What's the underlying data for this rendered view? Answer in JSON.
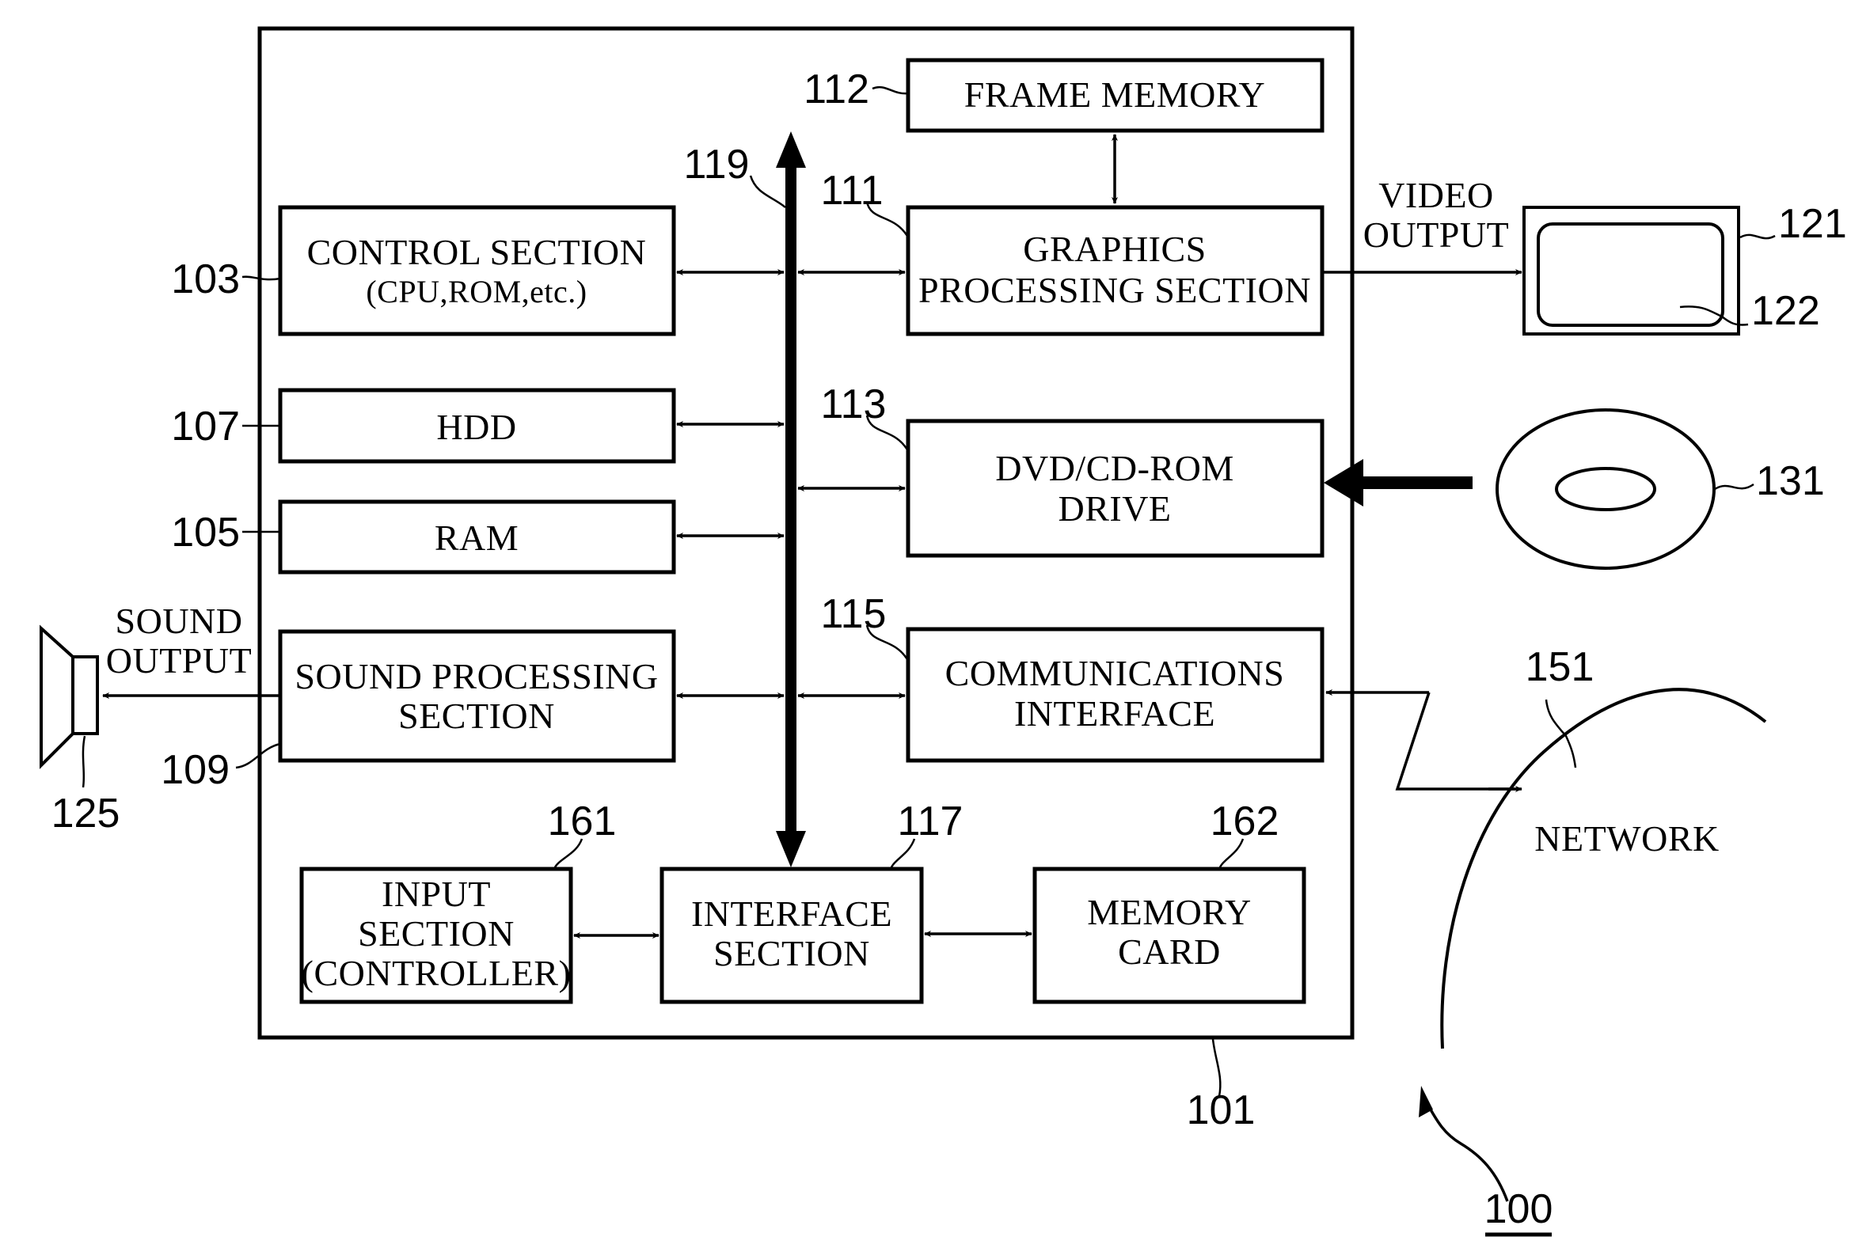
{
  "figure": {
    "system_ref": "100",
    "device_ref": "101",
    "bus_ref": "119"
  },
  "blocks": {
    "frame_memory": {
      "ref": "112",
      "lines": [
        "FRAME  MEMORY"
      ]
    },
    "graphics": {
      "ref": "111",
      "lines": [
        "GRAPHICS",
        "PROCESSING SECTION"
      ]
    },
    "control": {
      "ref": "103",
      "lines": [
        "CONTROL  SECTION",
        "(CPU,ROM,etc.)"
      ]
    },
    "hdd": {
      "ref": "107",
      "lines": [
        "HDD"
      ]
    },
    "ram": {
      "ref": "105",
      "lines": [
        "RAM"
      ]
    },
    "dvd": {
      "ref": "113",
      "lines": [
        "DVD/CD-ROM",
        "DRIVE"
      ]
    },
    "sound": {
      "ref": "109",
      "lines": [
        "SOUND  PROCESSING",
        "SECTION"
      ]
    },
    "comm": {
      "ref": "115",
      "lines": [
        "COMMUNICATIONS",
        "INTERFACE"
      ]
    },
    "input": {
      "ref": "161",
      "lines": [
        "INPUT",
        "SECTION",
        "(CONTROLLER)"
      ]
    },
    "interface": {
      "ref": "117",
      "lines": [
        "INTERFACE",
        "SECTION"
      ]
    },
    "memory_card": {
      "ref": "162",
      "lines": [
        "MEMORY",
        "CARD"
      ]
    }
  },
  "external": {
    "monitor": {
      "ref": "121",
      "screen_ref": "122"
    },
    "disc": {
      "ref": "131"
    },
    "speaker": {
      "ref": "125"
    },
    "network": {
      "ref": "151",
      "label": "NETWORK"
    }
  },
  "signals": {
    "video_output": [
      "VIDEO",
      "OUTPUT"
    ],
    "sound_output": [
      "SOUND",
      "OUTPUT"
    ]
  }
}
